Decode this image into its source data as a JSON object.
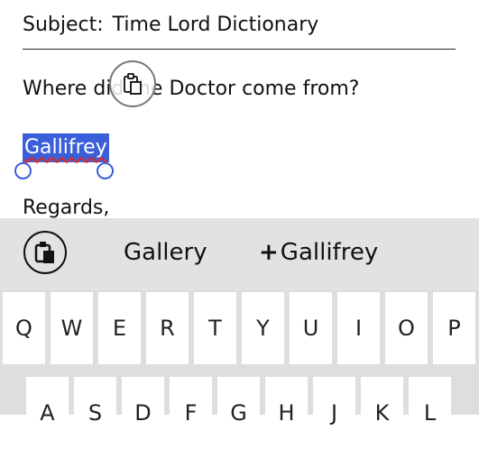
{
  "email": {
    "subject_label": "Subject:",
    "subject_value": "Time Lord Dictionary",
    "question": "Where did the Doctor come from?",
    "selected_word": "Gallifrey",
    "closing": "Regards,"
  },
  "suggestions": {
    "clipboard_icon": "clipboard-paste-icon",
    "items": [
      "Gallery",
      "Gallifrey"
    ],
    "add_prefix": "+"
  },
  "keyboard": {
    "row1": [
      "Q",
      "W",
      "E",
      "R",
      "T",
      "Y",
      "U",
      "I",
      "O",
      "P"
    ],
    "row2": [
      "A",
      "S",
      "D",
      "F",
      "G",
      "H",
      "J",
      "K",
      "L"
    ]
  },
  "colors": {
    "selection": "#3b5fd9",
    "spellcheck": "#d72a2a",
    "suggestion_bar": "#e2e2e2"
  }
}
